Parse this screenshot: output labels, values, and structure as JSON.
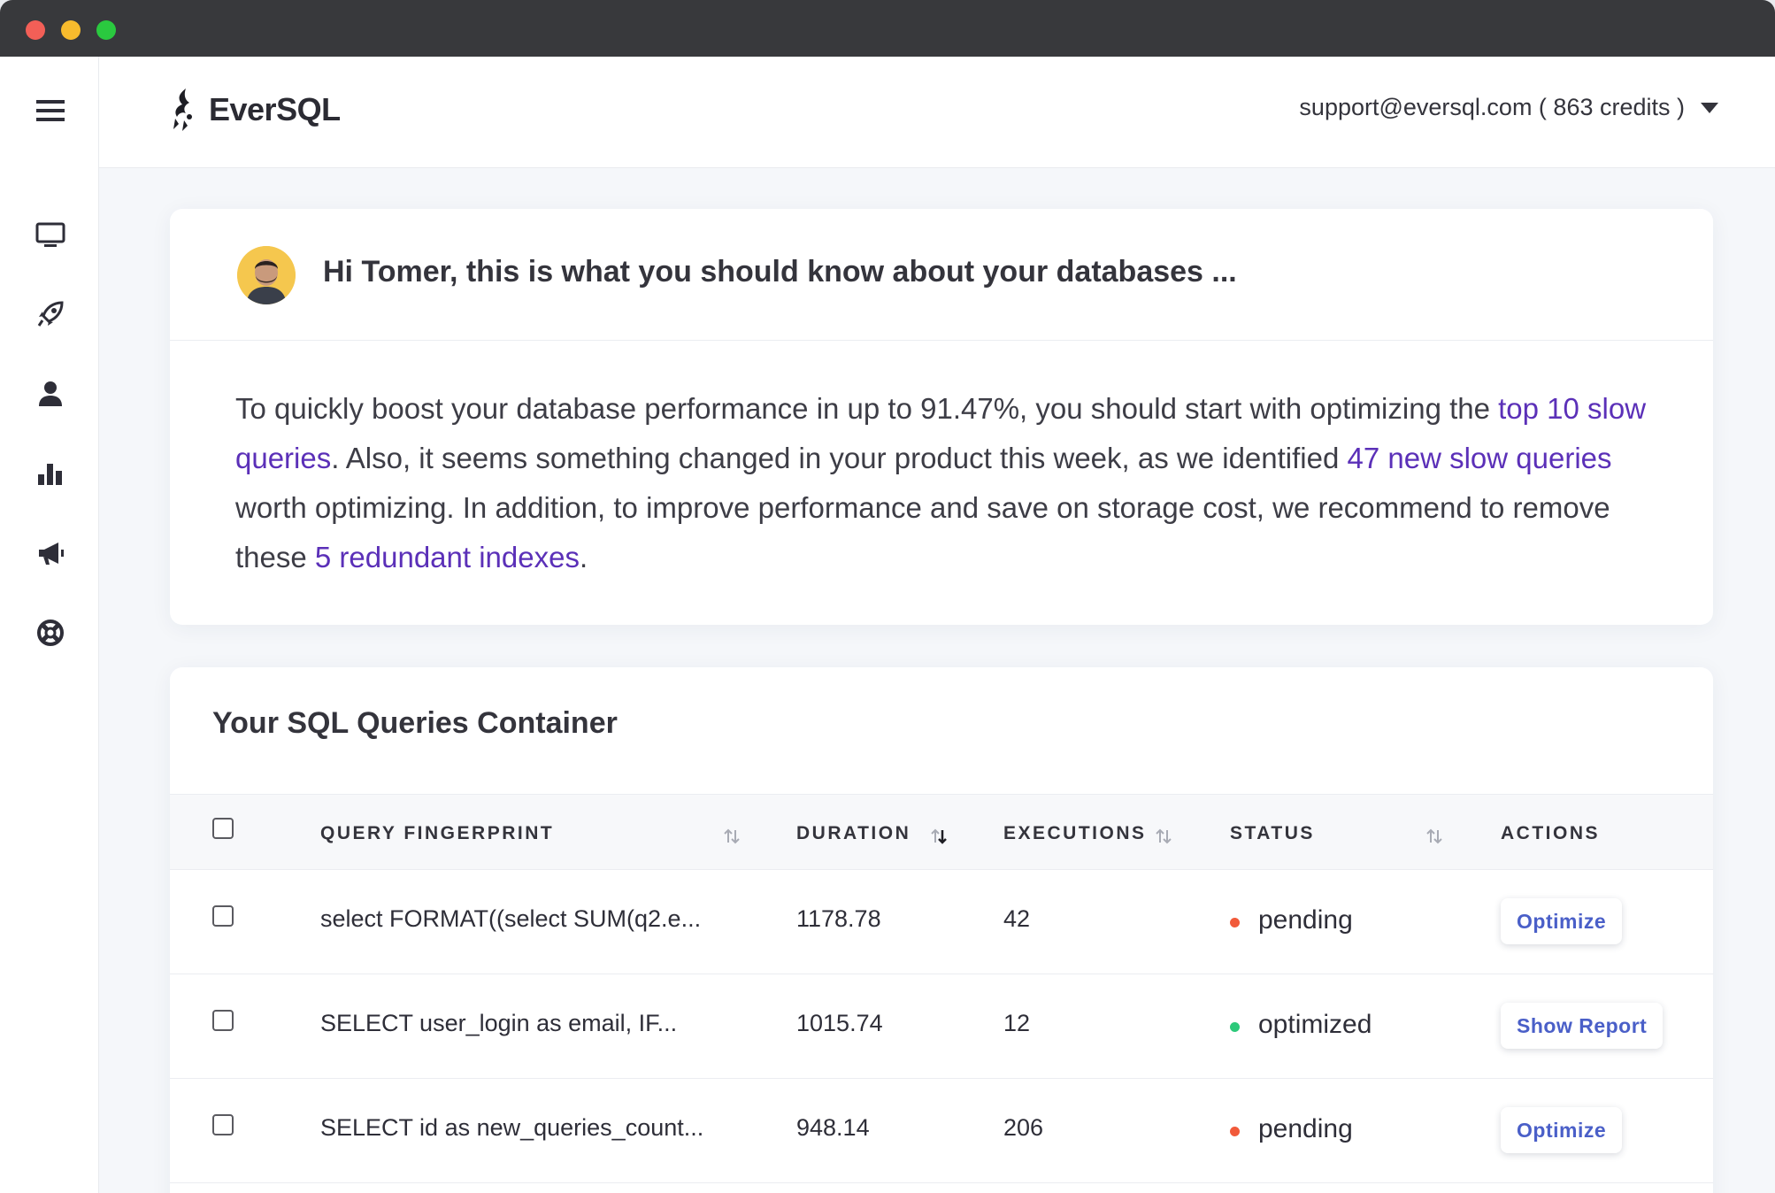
{
  "app": {
    "name": "EverSQL",
    "account_label": "support@eversql.com ( 863 credits )"
  },
  "sidebar": {
    "items": [
      {
        "icon": "menu-icon"
      },
      {
        "icon": "monitor-icon"
      },
      {
        "icon": "rocket-icon"
      },
      {
        "icon": "user-icon"
      },
      {
        "icon": "bar-chart-icon"
      },
      {
        "icon": "megaphone-icon"
      },
      {
        "icon": "lifebuoy-icon"
      }
    ]
  },
  "insights": {
    "greeting": "Hi Tomer, this is what you should know about your databases ...",
    "text_1": "To quickly boost your database performance in up to 91.47%, you should start with optimizing the ",
    "link_1": "top 10 slow queries",
    "text_2": ". Also, it seems something changed in your product this week, as we identified ",
    "link_2": "47 new slow queries",
    "text_3": " worth optimizing. In addition, to improve performance and save on storage cost, we recommend to remove these ",
    "link_3": "5 redundant indexes",
    "text_4": ".",
    "link_color": "#5b30b8"
  },
  "queries": {
    "title": "Your SQL Queries Container",
    "columns": {
      "fingerprint": "QUERY FINGERPRINT",
      "duration": "DURATION",
      "executions": "EXECUTIONS",
      "status": "STATUS",
      "actions": "ACTIONS"
    },
    "sorted_column": "DURATION",
    "rows": [
      {
        "fingerprint": "select FORMAT((select SUM(q2.e...",
        "duration": "1178.78",
        "executions": "42",
        "status": "pending",
        "status_color": "#f15a3a",
        "action": "Optimize"
      },
      {
        "fingerprint": "SELECT user_login as email, IF...",
        "duration": "1015.74",
        "executions": "12",
        "status": "optimized",
        "status_color": "#2cc97a",
        "action": "Show Report"
      },
      {
        "fingerprint": "SELECT id as new_queries_count...",
        "duration": "948.14",
        "executions": "206",
        "status": "pending",
        "status_color": "#f15a3a",
        "action": "Optimize"
      }
    ]
  }
}
